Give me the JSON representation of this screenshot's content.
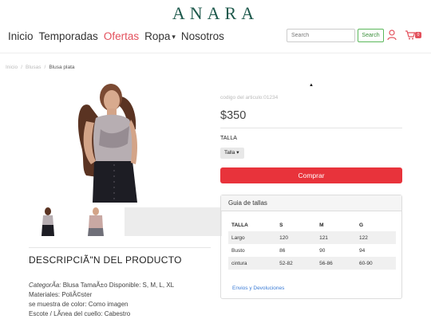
{
  "header": {
    "logo_text": "ANARA",
    "nav": [
      {
        "label": "Inicio",
        "active": false
      },
      {
        "label": "Temporadas",
        "active": false
      },
      {
        "label": "Ofertas",
        "active": true
      },
      {
        "label": "Ropa",
        "active": false,
        "dropdown": true
      },
      {
        "label": "Nosotros",
        "active": false
      }
    ],
    "search_placeholder": "Search",
    "search_button": "Search",
    "cart_count": "0"
  },
  "breadcrumb": [
    "Inicio",
    "Blusas",
    "Blusa plata"
  ],
  "product": {
    "code": "codigo del articulo:01234",
    "price": "$350",
    "size_label": "TALLA",
    "size_selected": "Talla",
    "buy_label": "Comprar"
  },
  "size_guide": {
    "title": "Guia de tallas",
    "headers": [
      "TALLA",
      "S",
      "M",
      "G"
    ],
    "rows": [
      [
        "Largo",
        "120",
        "121",
        "122"
      ],
      [
        "Busto",
        "86",
        "90",
        "94"
      ],
      [
        "cintura",
        "52-82",
        "56-86",
        "60-90"
      ]
    ],
    "shipping_link": "Envios y Devoluciones"
  },
  "description": {
    "title": "DESCRIPCIÃ\"N DEL PRODUCTO",
    "lines": [
      {
        "key": "CategorÃ­a:",
        "value": " Blusa TamaÃ±o Disponible: S, M, L, XL"
      },
      {
        "key": "",
        "value": "Materiales: PoliÃ©ster"
      },
      {
        "key": "",
        "value": "se muestra de color: Como imagen"
      },
      {
        "key": "",
        "value": "Escote / LÃ­nea del cuello: Cabestro"
      }
    ]
  },
  "colors": {
    "accent": "#e3505c",
    "buy_button": "#e8333b",
    "logo": "#1f5a4d",
    "search_button": "#5cb85c"
  }
}
